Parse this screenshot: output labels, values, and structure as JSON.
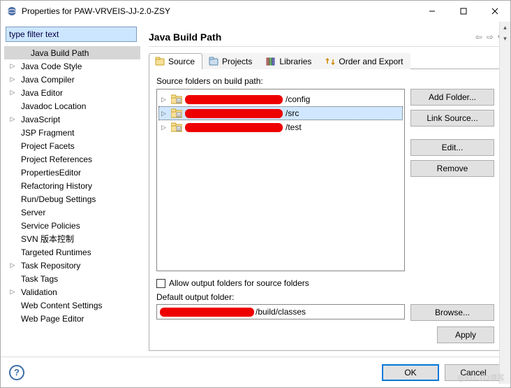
{
  "window": {
    "title": "Properties for PAW-VRVEIS-JJ-2.0-ZSY"
  },
  "sidebar": {
    "filter_value": "type filter text",
    "items": [
      {
        "label": "Java Build Path",
        "expandable": false,
        "selected": true,
        "indent": 1
      },
      {
        "label": "Java Code Style",
        "expandable": true
      },
      {
        "label": "Java Compiler",
        "expandable": true
      },
      {
        "label": "Java Editor",
        "expandable": true
      },
      {
        "label": "Javadoc Location",
        "expandable": false
      },
      {
        "label": "JavaScript",
        "expandable": true
      },
      {
        "label": "JSP Fragment",
        "expandable": false
      },
      {
        "label": "Project Facets",
        "expandable": false
      },
      {
        "label": "Project References",
        "expandable": false
      },
      {
        "label": "PropertiesEditor",
        "expandable": false
      },
      {
        "label": "Refactoring History",
        "expandable": false
      },
      {
        "label": "Run/Debug Settings",
        "expandable": false
      },
      {
        "label": "Server",
        "expandable": false
      },
      {
        "label": "Service Policies",
        "expandable": false
      },
      {
        "label": "SVN 版本控制",
        "expandable": false
      },
      {
        "label": "Targeted Runtimes",
        "expandable": false
      },
      {
        "label": "Task Repository",
        "expandable": true
      },
      {
        "label": "Task Tags",
        "expandable": false
      },
      {
        "label": "Validation",
        "expandable": true
      },
      {
        "label": "Web Content Settings",
        "expandable": false
      },
      {
        "label": "Web Page Editor",
        "expandable": false
      }
    ]
  },
  "main": {
    "heading": "Java Build Path",
    "tabs": [
      {
        "label": "Source",
        "icon": "source"
      },
      {
        "label": "Projects",
        "icon": "projects"
      },
      {
        "label": "Libraries",
        "icon": "libraries"
      },
      {
        "label": "Order and Export",
        "icon": "order"
      }
    ],
    "src_label": "Source folders on build path:",
    "src_items": [
      {
        "suffix": "/config",
        "selected": false
      },
      {
        "suffix": "/src",
        "selected": true
      },
      {
        "suffix": "/test",
        "selected": false
      }
    ],
    "buttons": {
      "add_folder": "Add Folder...",
      "link_source": "Link Source...",
      "edit": "Edit...",
      "remove": "Remove",
      "browse": "Browse...",
      "apply": "Apply"
    },
    "allow_output": "Allow output folders for source folders",
    "default_output_label": "Default output folder:",
    "default_output_suffix": "/build/classes"
  },
  "footer": {
    "ok": "OK",
    "cancel": "Cancel"
  },
  "watermark": "@51CTO博客"
}
